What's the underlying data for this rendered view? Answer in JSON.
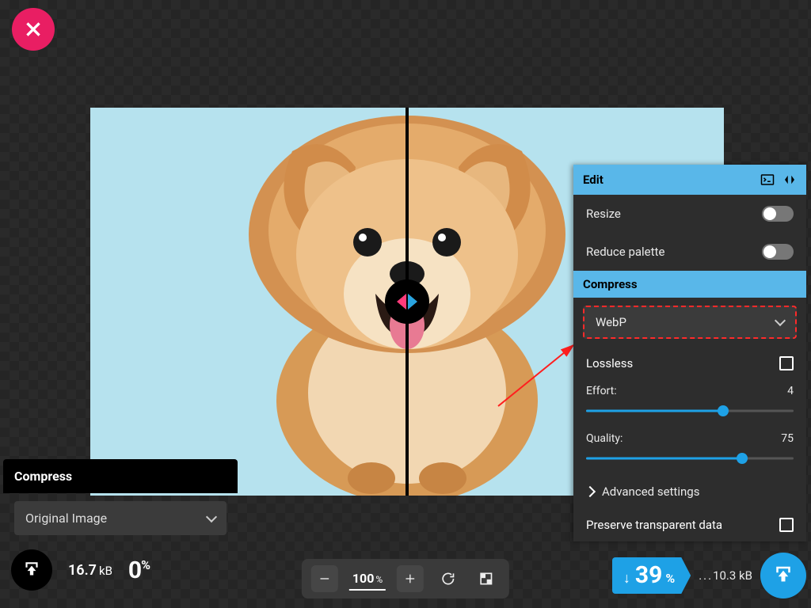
{
  "close": {
    "label": "Close"
  },
  "left": {
    "title": "Compress",
    "select_label": "Original Image",
    "size_value": "16.7",
    "size_unit": "kB",
    "pct_value": "0",
    "pct_sign": "%"
  },
  "toolbar": {
    "zoom_value": "100",
    "zoom_pct": "%"
  },
  "panel": {
    "edit_title": "Edit",
    "resize_label": "Resize",
    "reduce_label": "Reduce palette",
    "compress_title": "Compress",
    "format_value": "WebP",
    "lossless_label": "Lossless",
    "effort_label": "Effort:",
    "effort_value": "4",
    "effort_pct": 66,
    "quality_label": "Quality:",
    "quality_value": "75",
    "quality_pct": 75,
    "advanced_label": "Advanced settings",
    "preserve_label": "Preserve transparent data"
  },
  "result": {
    "save_pct": "39",
    "pct_sign": "%",
    "dots": "...",
    "out_value": "10.3",
    "out_unit": "kB"
  }
}
